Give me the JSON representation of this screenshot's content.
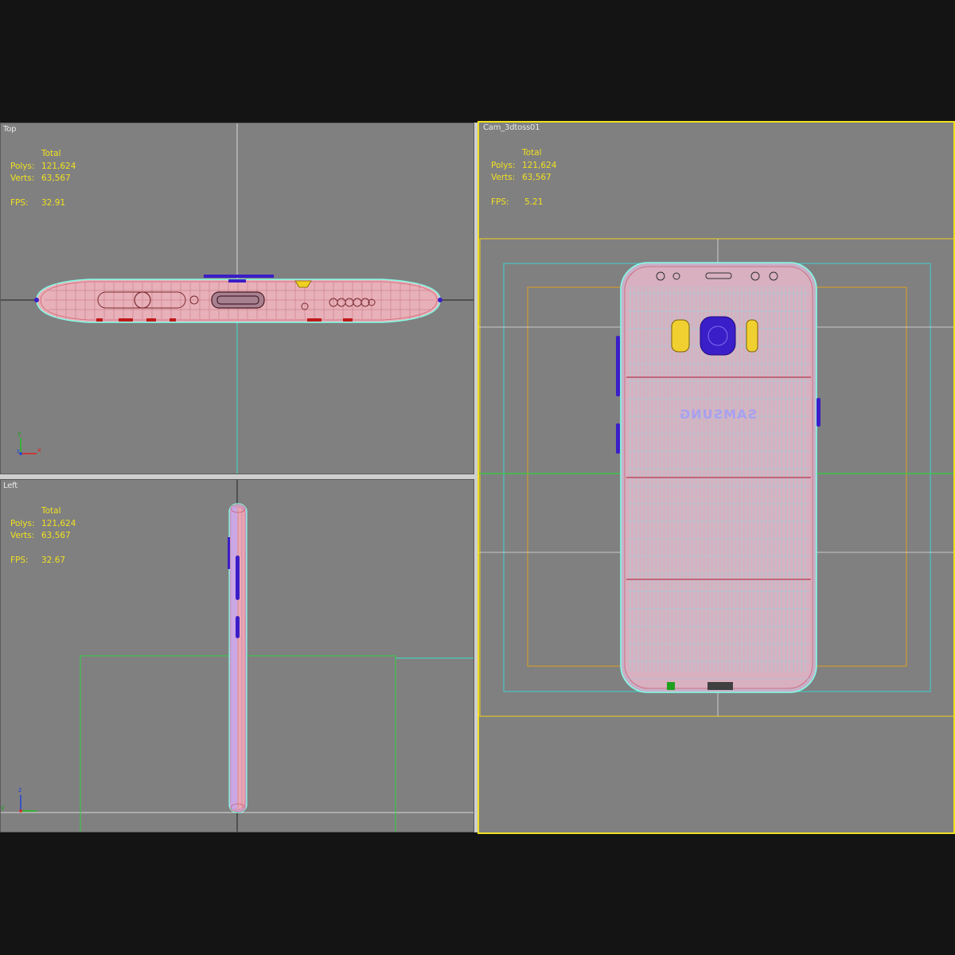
{
  "viewports": {
    "top": {
      "label": "Top",
      "stats": {
        "total_label": "Total",
        "polys_label": "Polys:",
        "polys": "121,624",
        "verts_label": "Verts:",
        "verts": "63,567",
        "fps_label": "FPS:",
        "fps": "32.91"
      },
      "gizmo": {
        "y": "y",
        "x": "x",
        "z": "z"
      }
    },
    "left": {
      "label": "Left",
      "stats": {
        "total_label": "Total",
        "polys_label": "Polys:",
        "polys": "121,624",
        "verts_label": "Verts:",
        "verts": "63,567",
        "fps_label": "FPS:",
        "fps": "32.67"
      },
      "gizmo": {
        "y": "z",
        "x": "y"
      }
    },
    "camera": {
      "label": "Cam_3dtoss01",
      "stats": {
        "total_label": "Total",
        "polys_label": "Polys:",
        "polys": "121,624",
        "verts_label": "Verts:",
        "verts": "63,567",
        "fps_label": "FPS:",
        "fps": "5.21"
      },
      "brand_mirrored": "SAMSUNG",
      "active": true
    }
  },
  "colors": {
    "viewport_bg": "#808080",
    "active_border": "#f0e020",
    "stats_text": "#f0e020",
    "wire_pink": "#f0a0a0",
    "wire_cyan": "#80ffe8",
    "button_blue": "#3a1ec8",
    "safe_frame_cyan": "#40d0d0",
    "safe_frame_orange": "#e0a020"
  }
}
